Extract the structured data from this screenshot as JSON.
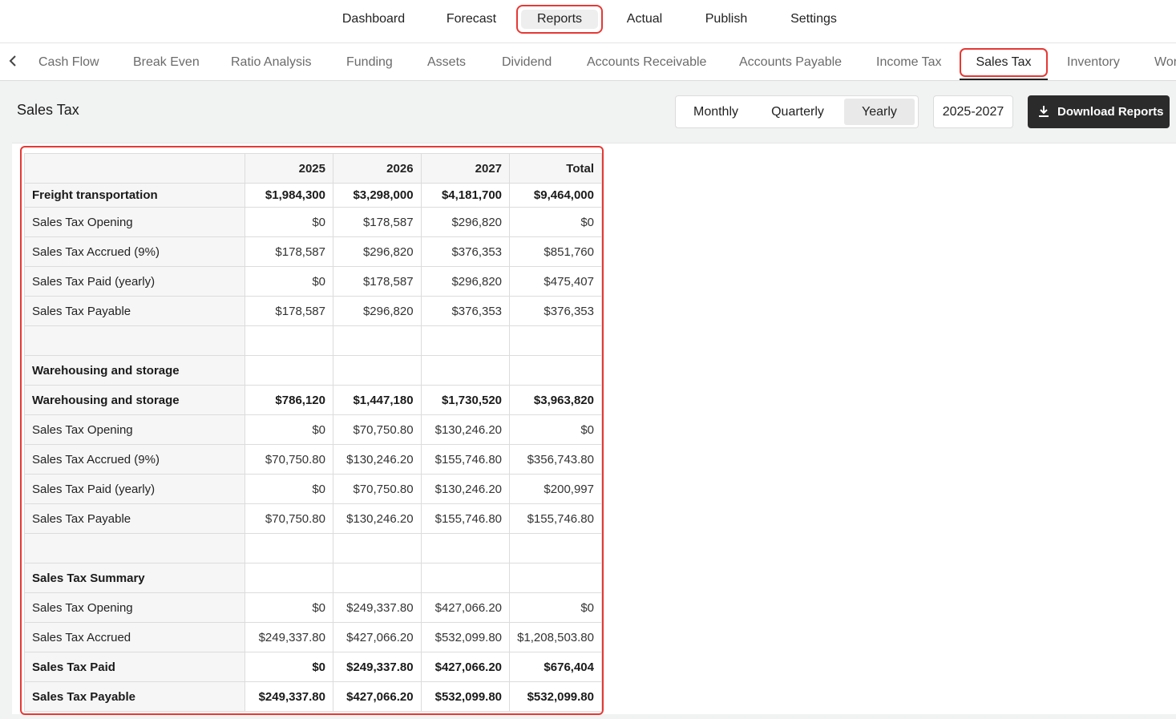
{
  "topnav": {
    "items": [
      {
        "label": "Dashboard"
      },
      {
        "label": "Forecast"
      },
      {
        "label": "Reports"
      },
      {
        "label": "Actual"
      },
      {
        "label": "Publish"
      },
      {
        "label": "Settings"
      }
    ],
    "active": "Reports"
  },
  "subnav": {
    "tabs": [
      {
        "label": "Cash Flow"
      },
      {
        "label": "Break Even"
      },
      {
        "label": "Ratio Analysis"
      },
      {
        "label": "Funding"
      },
      {
        "label": "Assets"
      },
      {
        "label": "Dividend"
      },
      {
        "label": "Accounts Receivable"
      },
      {
        "label": "Accounts Payable"
      },
      {
        "label": "Income Tax"
      },
      {
        "label": "Sales Tax"
      },
      {
        "label": "Inventory"
      },
      {
        "label": "Wor"
      }
    ],
    "active": "Sales Tax",
    "back_icon": "chevron-left-icon"
  },
  "page": {
    "title": "Sales Tax",
    "period_options": [
      "Monthly",
      "Quarterly",
      "Yearly"
    ],
    "period_selected": "Yearly",
    "range": "2025-2027",
    "download_label": "Download Reports",
    "download_icon": "download-icon"
  },
  "table": {
    "headers": [
      "",
      "2025",
      "2026",
      "2027",
      "Total"
    ],
    "rows": [
      {
        "bold": true,
        "cells": [
          "Freight transportation",
          "$1,984,300",
          "$3,298,000",
          "$4,181,700",
          "$9,464,000"
        ]
      },
      {
        "bold": false,
        "cells": [
          "Sales Tax Opening",
          "$0",
          "$178,587",
          "$296,820",
          "$0"
        ]
      },
      {
        "bold": false,
        "cells": [
          "Sales Tax Accrued (9%)",
          "$178,587",
          "$296,820",
          "$376,353",
          "$851,760"
        ]
      },
      {
        "bold": false,
        "cells": [
          "Sales Tax Paid (yearly)",
          "$0",
          "$178,587",
          "$296,820",
          "$475,407"
        ]
      },
      {
        "bold": false,
        "cells": [
          "Sales Tax Payable",
          "$178,587",
          "$296,820",
          "$376,353",
          "$376,353"
        ]
      },
      {
        "bold": false,
        "cells": [
          "",
          "",
          "",
          "",
          ""
        ]
      },
      {
        "bold": true,
        "cells": [
          "Warehousing and storage",
          "",
          "",
          "",
          ""
        ]
      },
      {
        "bold": true,
        "cells": [
          "Warehousing and storage",
          "$786,120",
          "$1,447,180",
          "$1,730,520",
          "$3,963,820"
        ]
      },
      {
        "bold": false,
        "cells": [
          "Sales Tax Opening",
          "$0",
          "$70,750.80",
          "$130,246.20",
          "$0"
        ]
      },
      {
        "bold": false,
        "cells": [
          "Sales Tax Accrued (9%)",
          "$70,750.80",
          "$130,246.20",
          "$155,746.80",
          "$356,743.80"
        ]
      },
      {
        "bold": false,
        "cells": [
          "Sales Tax Paid (yearly)",
          "$0",
          "$70,750.80",
          "$130,246.20",
          "$200,997"
        ]
      },
      {
        "bold": false,
        "cells": [
          "Sales Tax Payable",
          "$70,750.80",
          "$130,246.20",
          "$155,746.80",
          "$155,746.80"
        ]
      },
      {
        "bold": false,
        "cells": [
          "",
          "",
          "",
          "",
          ""
        ]
      },
      {
        "bold": true,
        "cells": [
          "Sales Tax Summary",
          "",
          "",
          "",
          ""
        ]
      },
      {
        "bold": false,
        "cells": [
          "Sales Tax Opening",
          "$0",
          "$249,337.80",
          "$427,066.20",
          "$0"
        ]
      },
      {
        "bold": false,
        "cells": [
          "Sales Tax Accrued",
          "$249,337.80",
          "$427,066.20",
          "$532,099.80",
          "$1,208,503.80"
        ]
      },
      {
        "bold": true,
        "cells": [
          "Sales Tax Paid",
          "$0",
          "$249,337.80",
          "$427,066.20",
          "$676,404"
        ]
      },
      {
        "bold": true,
        "cells": [
          "Sales Tax Payable",
          "$249,337.80",
          "$427,066.20",
          "$532,099.80",
          "$532,099.80"
        ]
      }
    ]
  },
  "colors": {
    "highlight": "#e53935",
    "button_dark": "#2b2b2b",
    "content_bg": "#f1f2f2"
  }
}
